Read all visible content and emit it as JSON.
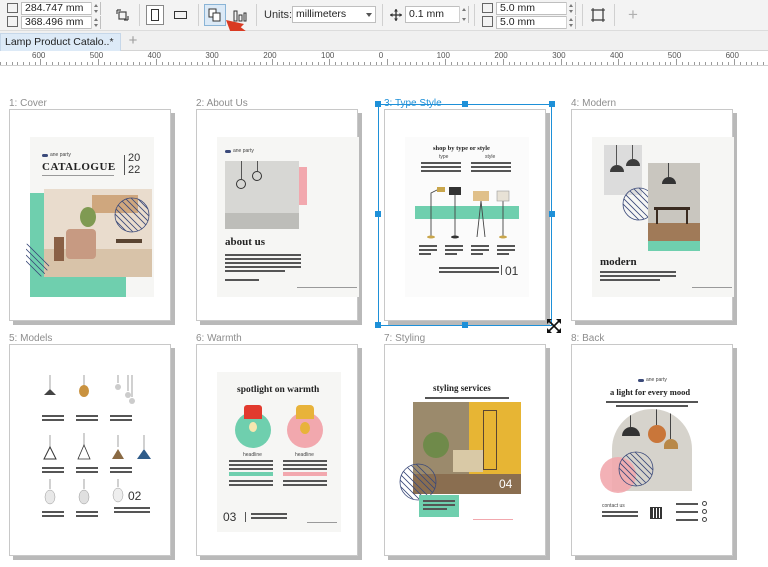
{
  "toolbar": {
    "width_value": "284.747 mm",
    "height_value": "368.496 mm",
    "units_label": "Units:",
    "units_value": "millimeters",
    "nudge_value": "0.1 mm",
    "dup_x_value": "5.0 mm",
    "dup_y_value": "5.0 mm"
  },
  "tabs": {
    "doc_title": "Lamp Product Catalo..*"
  },
  "ruler": {
    "labels": [
      "600",
      "500",
      "400",
      "300",
      "200",
      "100",
      "0",
      "100",
      "200",
      "300",
      "400",
      "500",
      "600"
    ]
  },
  "pages": [
    {
      "label": "1: Cover"
    },
    {
      "label": "2: About Us"
    },
    {
      "label": "3: Type Style"
    },
    {
      "label": "4: Modern"
    },
    {
      "label": "5: Models"
    },
    {
      "label": "6: Warmth"
    },
    {
      "label": "7: Styling"
    },
    {
      "label": "8: Back"
    }
  ],
  "content": {
    "cover_company": "ane party",
    "cover_title": "CATALOGUE",
    "cover_year_top": "20",
    "cover_year_bottom": "22",
    "about_company": "ane party",
    "about_heading": "about us",
    "type_heading": "shop by type or style",
    "type_col1": "type",
    "type_col2": "style",
    "type_number": "01",
    "modern_heading": "modern",
    "models_number": "02",
    "warmth_heading": "spotlight on warmth",
    "warmth_sub1": "headline",
    "warmth_sub2": "headline",
    "warmth_number": "03",
    "styling_heading": "styling services",
    "styling_number": "04",
    "back_company": "ane party",
    "back_heading": "a light for every mood",
    "back_contact": "contact us"
  },
  "colors": {
    "accent": "#1e90d8",
    "mint": "#6fcfae",
    "pink": "#f2a8ae",
    "navy": "#3b4a7a",
    "arrow": "#d93a22"
  }
}
